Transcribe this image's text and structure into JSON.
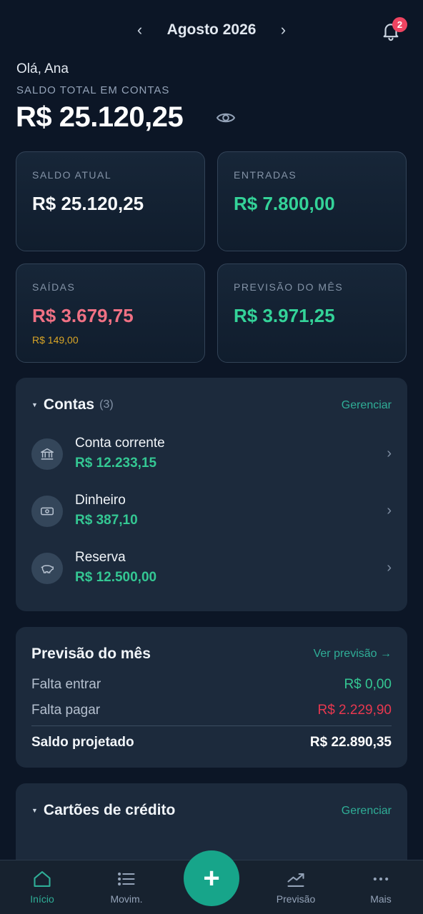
{
  "header": {
    "prev": "‹",
    "month": "Agosto 2026",
    "next": "›",
    "notification_count": "2"
  },
  "greeting": "Olá, Ana",
  "total": {
    "label": "SALDO TOTAL EM CONTAS",
    "value": "R$ 25.120,25"
  },
  "cards": {
    "saldo_atual": {
      "label": "SALDO ATUAL",
      "value": "R$ 25.120,25"
    },
    "entradas": {
      "label": "ENTRADAS",
      "value": "R$ 7.800,00"
    },
    "saidas": {
      "label": "SAÍDAS",
      "value": "R$ 3.679,75",
      "sub": "R$ 149,00"
    },
    "previsao": {
      "label": "PREVISÃO DO MÊS",
      "value": "R$ 3.971,25"
    }
  },
  "accounts": {
    "title": "Contas",
    "count": "(3)",
    "manage": "Gerenciar",
    "items": [
      {
        "name": "Conta corrente",
        "value": "R$ 12.233,15",
        "icon": "bank-icon"
      },
      {
        "name": "Dinheiro",
        "value": "R$ 387,10",
        "icon": "cash-icon"
      },
      {
        "name": "Reserva",
        "value": "R$ 12.500,00",
        "icon": "piggy-bank-icon"
      }
    ]
  },
  "forecast": {
    "title": "Previsão do mês",
    "link": "Ver previsão →",
    "rows": [
      {
        "label": "Falta entrar",
        "value": "R$ 0,00"
      },
      {
        "label": "Falta pagar",
        "value": "R$ 2.229,90"
      }
    ],
    "projected": {
      "label": "Saldo projetado",
      "value": "R$ 22.890,35"
    }
  },
  "cards_panel": {
    "title": "Cartões de crédito",
    "manage": "Gerenciar"
  },
  "nav": {
    "items": [
      {
        "label": "Início",
        "icon": "home-icon"
      },
      {
        "label": "Movim.",
        "icon": "list-icon"
      },
      {
        "label": "Previsão",
        "icon": "trend-icon"
      },
      {
        "label": "Mais",
        "icon": "more-icon"
      }
    ],
    "fab": "+"
  },
  "colors": {
    "accent": "#2fae97",
    "income": "#34d399",
    "expense": "#f07184",
    "warning": "#d9a526",
    "danger": "#e8384f"
  }
}
